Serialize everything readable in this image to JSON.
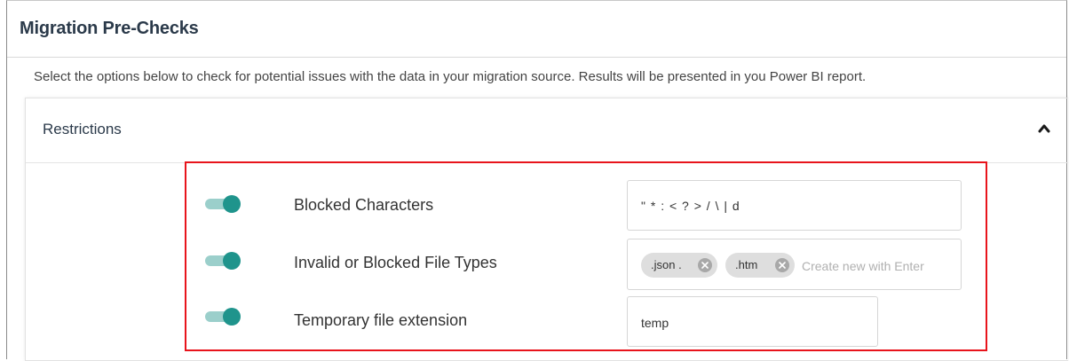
{
  "page": {
    "title": "Migration Pre-Checks",
    "description": "Select the options below to check for potential issues with the data in your migration source. Results will be presented in you Power BI report."
  },
  "restrictions": {
    "title": "Restrictions",
    "expanded": true,
    "toggle_color": "#1f948c",
    "highlight_color": "#e8141c",
    "rows": [
      {
        "label": "Blocked Characters",
        "enabled": true,
        "value": "\" * : < ? > / \\ | d"
      },
      {
        "label": "Invalid or Blocked File Types",
        "enabled": true,
        "chips": [
          ".json .",
          ".htm"
        ],
        "placeholder": "Create new with Enter"
      },
      {
        "label": "Temporary file extension",
        "enabled": true,
        "value": "temp"
      }
    ]
  }
}
